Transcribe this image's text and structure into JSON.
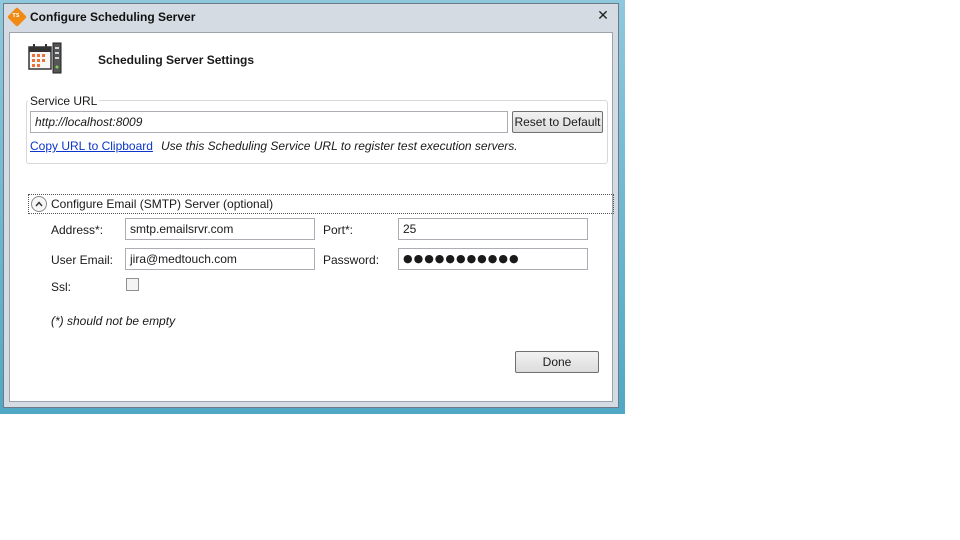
{
  "window": {
    "title": "Configure Scheduling Server",
    "app_icon": "ts-logo-icon",
    "close_glyph": "✕"
  },
  "header": {
    "title": "Scheduling Server Settings",
    "icon": "calendar-server-icon"
  },
  "service_url": {
    "group_label": "Service URL",
    "value": "http://localhost:8009",
    "reset_label": "Reset to Default",
    "copy_link": "Copy URL to Clipboard",
    "hint": "Use this Scheduling Service URL to register test execution servers."
  },
  "email": {
    "expander_label": "Configure Email (SMTP) Server (optional)",
    "expanded": true,
    "address_label": "Address*:",
    "address_value": "smtp.emailsrvr.com",
    "port_label": "Port*:",
    "port_value": "25",
    "user_label": "User Email:",
    "user_value": "jira@medtouch.com",
    "password_label": "Password:",
    "password_value": "●●●●●●●●●●●",
    "ssl_label": "Ssl:",
    "ssl_checked": false,
    "note": "(*) should not be empty"
  },
  "footer": {
    "done_label": "Done"
  }
}
